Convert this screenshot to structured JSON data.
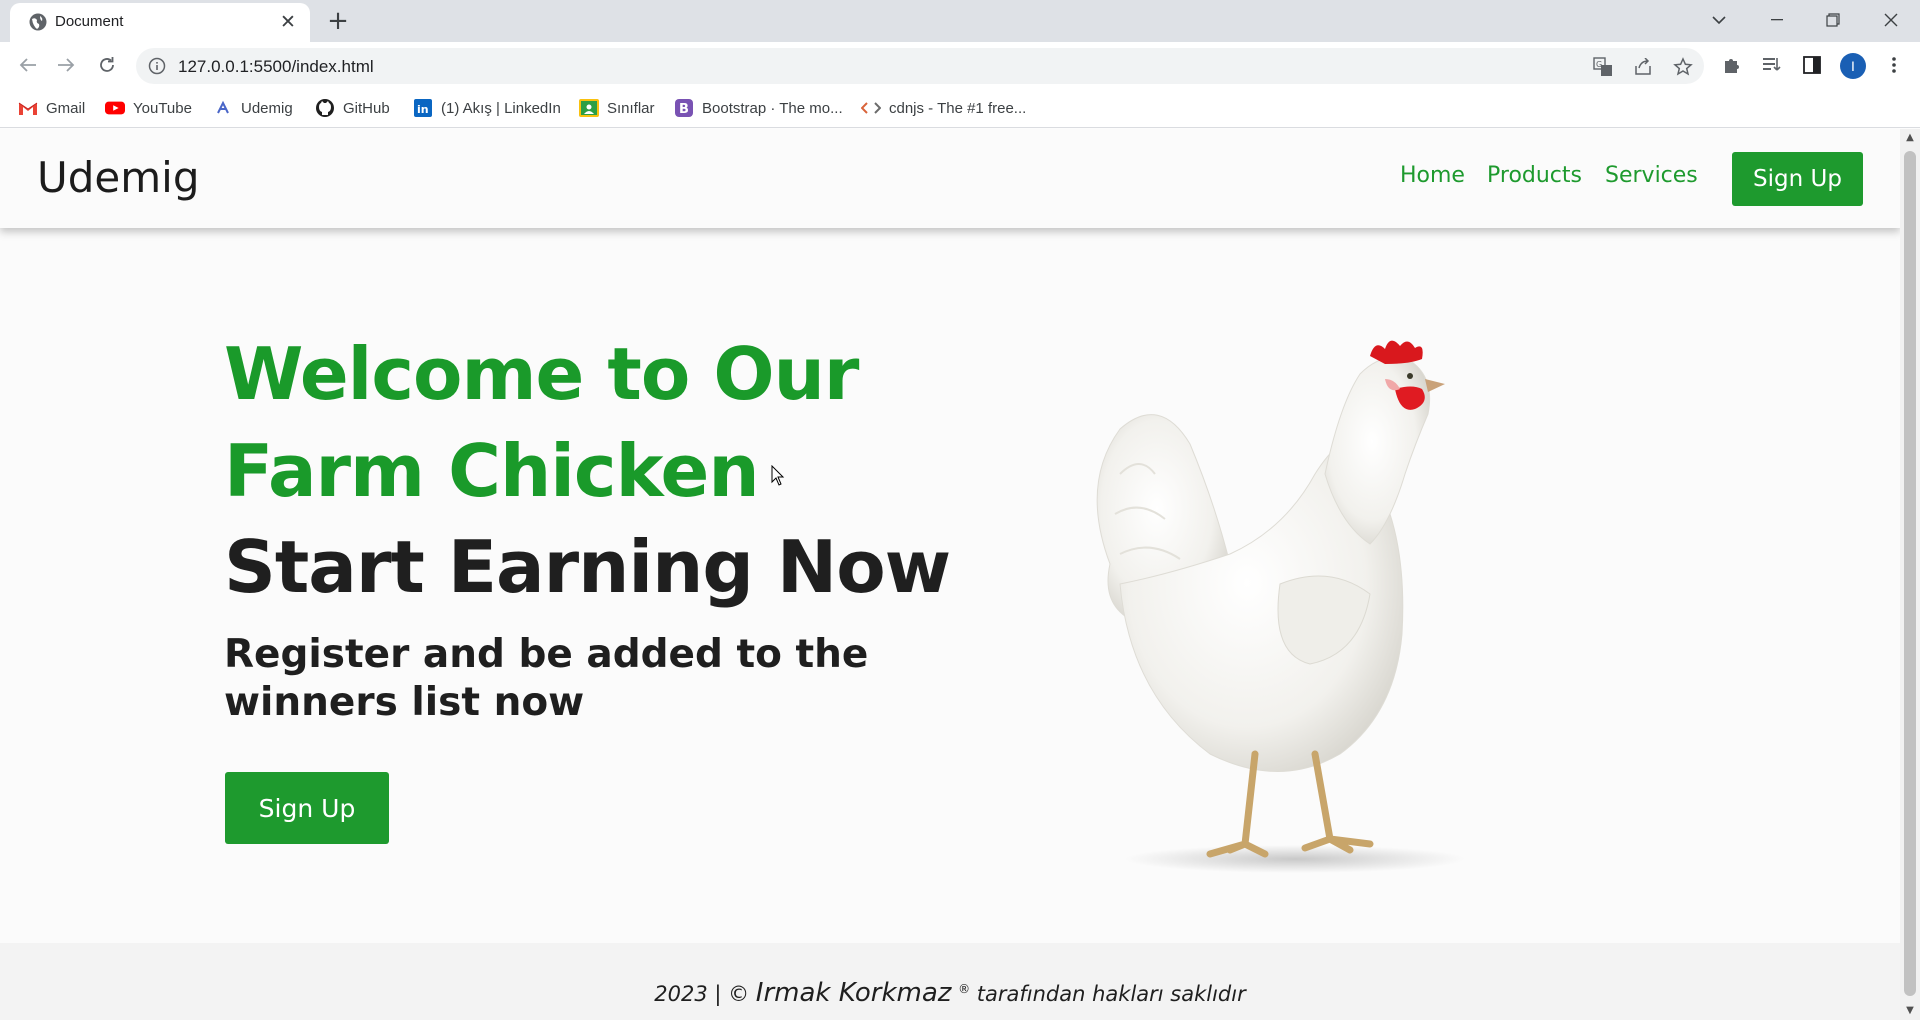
{
  "browser": {
    "tab_title": "Document",
    "url": "127.0.0.1:5500/index.html",
    "profile_initial": "I",
    "bookmarks": [
      {
        "label": "Gmail",
        "icon": "gmail-icon"
      },
      {
        "label": "YouTube",
        "icon": "youtube-icon"
      },
      {
        "label": "Udemig",
        "icon": "udemig-icon"
      },
      {
        "label": "GitHub",
        "icon": "github-icon"
      },
      {
        "label": "(1) Akış | LinkedIn",
        "icon": "linkedin-icon"
      },
      {
        "label": "Sınıflar",
        "icon": "classroom-icon"
      },
      {
        "label": "Bootstrap · The mo...",
        "icon": "bootstrap-icon"
      },
      {
        "label": "cdnjs - The #1 free...",
        "icon": "cdnjs-icon"
      }
    ]
  },
  "site": {
    "brand": "Udemig",
    "nav": [
      "Home",
      "Products",
      "Services"
    ],
    "header_cta": "Sign Up",
    "hero": {
      "line1": "Welcome to Our",
      "line2": "Farm Chicken",
      "line3": "Start Earning Now",
      "sub1": "Register and be added to the",
      "sub2": "winners list now",
      "cta": "Sign Up"
    },
    "footer": {
      "prefix": "2023 | © ",
      "name": "Irmak Korkmaz",
      "reg": "®",
      "suffix": " tarafından hakları saklıdır"
    }
  },
  "colors": {
    "accent": "#1e9a2e",
    "text_dark": "#1f1f1f",
    "page_bg": "#fbfbfb",
    "footer_bg": "#f3f3f3"
  }
}
